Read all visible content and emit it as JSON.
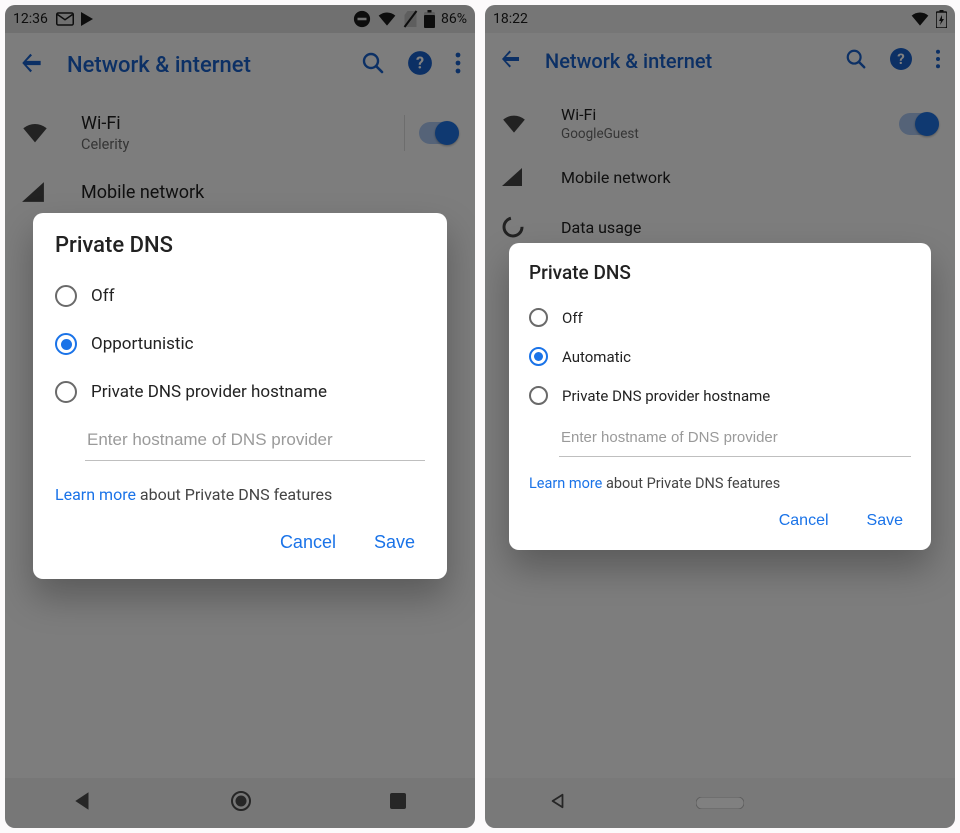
{
  "left": {
    "status": {
      "time": "12:36",
      "battery": "86%"
    },
    "appbar_title": "Network & internet",
    "wifi": {
      "label": "Wi-Fi",
      "ssid": "Celerity"
    },
    "mobile": {
      "label": "Mobile network"
    },
    "dialog": {
      "title": "Private DNS",
      "options": [
        "Off",
        "Opportunistic",
        "Private DNS provider hostname"
      ],
      "selected": 1,
      "placeholder": "Enter hostname of DNS provider",
      "learn_link": "Learn more",
      "learn_rest": " about Private DNS features",
      "cancel": "Cancel",
      "save": "Save"
    }
  },
  "right": {
    "status": {
      "time": "18:22"
    },
    "appbar_title": "Network & internet",
    "wifi": {
      "label": "Wi-Fi",
      "ssid": "GoogleGuest"
    },
    "mobile": {
      "label": "Mobile network"
    },
    "data_usage": {
      "label": "Data usage"
    },
    "dialog": {
      "title": "Private DNS",
      "options": [
        "Off",
        "Automatic",
        "Private DNS provider hostname"
      ],
      "selected": 1,
      "placeholder": "Enter hostname of DNS provider",
      "learn_link": "Learn more",
      "learn_rest": " about Private DNS features",
      "cancel": "Cancel",
      "save": "Save"
    }
  }
}
